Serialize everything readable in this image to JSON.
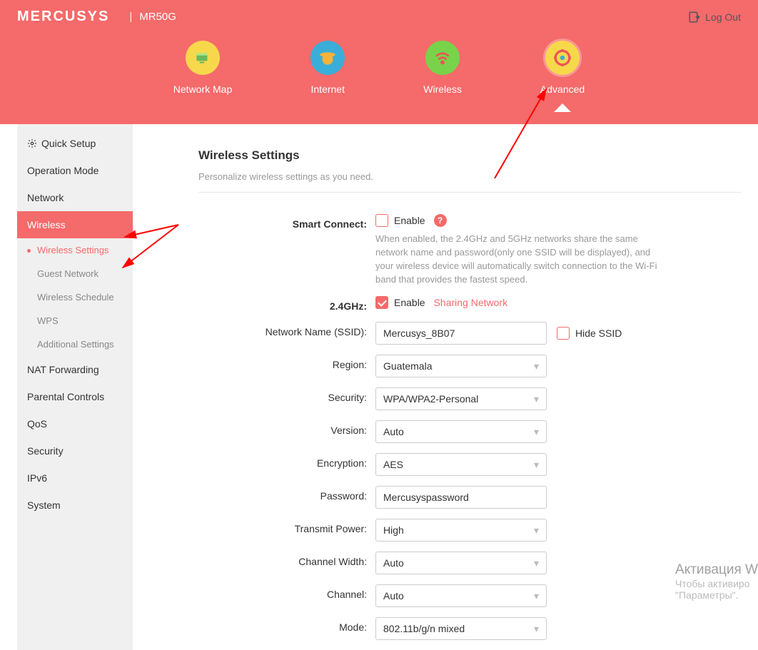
{
  "brand": "MERCUSYS",
  "model": "MR50G",
  "logout_label": "Log Out",
  "nav": {
    "network_map": "Network Map",
    "internet": "Internet",
    "wireless": "Wireless",
    "advanced": "Advanced"
  },
  "sidebar": {
    "quick_setup": "Quick Setup",
    "operation_mode": "Operation Mode",
    "network": "Network",
    "wireless": "Wireless",
    "wireless_settings": "Wireless Settings",
    "guest_network": "Guest Network",
    "wireless_schedule": "Wireless Schedule",
    "wps": "WPS",
    "additional_settings": "Additional Settings",
    "nat_forwarding": "NAT Forwarding",
    "parental_controls": "Parental Controls",
    "qos": "QoS",
    "security": "Security",
    "ipv6": "IPv6",
    "system": "System"
  },
  "page": {
    "title": "Wireless Settings",
    "subtitle": "Personalize wireless settings as you need."
  },
  "form": {
    "smart_connect_label": "Smart Connect:",
    "enable": "Enable",
    "smart_connect_help": "When enabled, the 2.4GHz and 5GHz networks share the same network name and password(only one SSID will be displayed), and your wireless device will automatically switch connection to the Wi-Fi band that provides the fastest speed.",
    "band_24_label": "2.4GHz:",
    "sharing_network": "Sharing Network",
    "ssid_label": "Network Name (SSID):",
    "ssid_value": "Mercusys_8B07",
    "hide_ssid": "Hide SSID",
    "region_label": "Region:",
    "region_value": "Guatemala",
    "security_label": "Security:",
    "security_value": "WPA/WPA2-Personal",
    "version_label": "Version:",
    "version_value": "Auto",
    "encryption_label": "Encryption:",
    "encryption_value": "AES",
    "password_label": "Password:",
    "password_value": "Mercusyspassword",
    "transmit_power_label": "Transmit Power:",
    "transmit_power_value": "High",
    "channel_width_label": "Channel Width:",
    "channel_width_value": "Auto",
    "channel_label": "Channel:",
    "channel_value": "Auto",
    "mode_label": "Mode:",
    "mode_value": "802.11b/g/n mixed"
  },
  "watermark": {
    "line1": "Активация W",
    "line2": "Чтобы активиро",
    "line3": "\"Параметры\"."
  }
}
